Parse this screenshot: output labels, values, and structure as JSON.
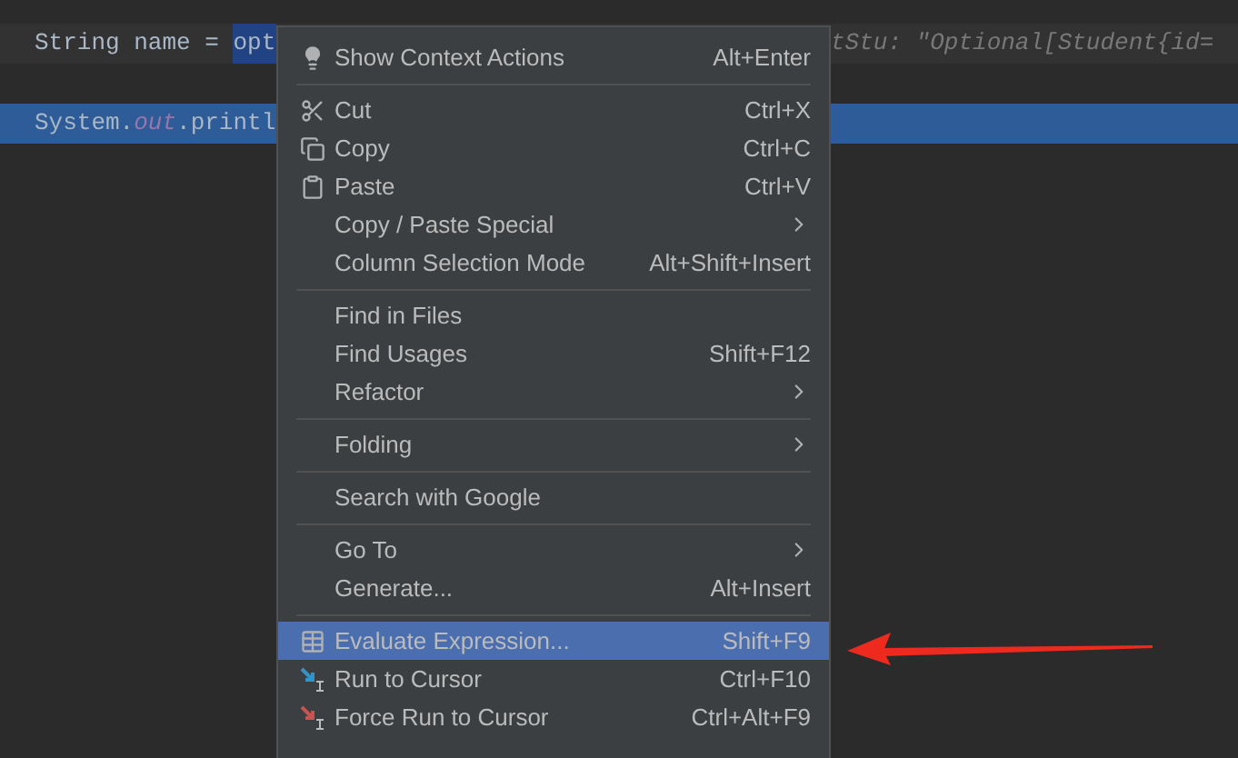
{
  "editor": {
    "lines": [
      {
        "current": true,
        "selected": false,
        "segments": [
          {
            "text": "String name = ",
            "kind": "plain"
          },
          {
            "text": "opt",
            "kind": "selection"
          }
        ],
        "hint": "tStu: \"Optional[Student{id="
      },
      {
        "selected": true,
        "segments": [
          {
            "text": "System.",
            "kind": "plain"
          },
          {
            "text": "out",
            "kind": "field"
          },
          {
            "text": ".printl",
            "kind": "plain"
          }
        ]
      }
    ]
  },
  "context_menu": {
    "items": [
      {
        "kind": "item",
        "label": "Show Context Actions",
        "shortcut": "Alt+Enter",
        "submenu": false,
        "selected": false
      },
      {
        "kind": "separator"
      },
      {
        "kind": "item",
        "label": "Cut",
        "shortcut": "Ctrl+X",
        "submenu": false,
        "selected": false
      },
      {
        "kind": "item",
        "label": "Copy",
        "shortcut": "Ctrl+C",
        "submenu": false,
        "selected": false
      },
      {
        "kind": "item",
        "label": "Paste",
        "shortcut": "Ctrl+V",
        "submenu": false,
        "selected": false
      },
      {
        "kind": "item",
        "label": "Copy / Paste Special",
        "submenu": true,
        "selected": false
      },
      {
        "kind": "item",
        "label": "Column Selection Mode",
        "shortcut": "Alt+Shift+Insert",
        "submenu": false,
        "selected": false
      },
      {
        "kind": "separator"
      },
      {
        "kind": "item",
        "label": "Find in Files",
        "submenu": false,
        "selected": false
      },
      {
        "kind": "item",
        "label": "Find Usages",
        "shortcut": "Shift+F12",
        "submenu": false,
        "selected": false
      },
      {
        "kind": "item",
        "label": "Refactor",
        "submenu": true,
        "selected": false
      },
      {
        "kind": "separator"
      },
      {
        "kind": "item",
        "label": "Folding",
        "submenu": true,
        "selected": false
      },
      {
        "kind": "separator"
      },
      {
        "kind": "item",
        "label": "Search with Google",
        "submenu": false,
        "selected": false
      },
      {
        "kind": "separator"
      },
      {
        "kind": "item",
        "label": "Go To",
        "submenu": true,
        "selected": false
      },
      {
        "kind": "item",
        "label": "Generate...",
        "shortcut": "Alt+Insert",
        "submenu": false,
        "selected": false
      },
      {
        "kind": "separator"
      },
      {
        "kind": "item",
        "label": "Evaluate Expression...",
        "shortcut": "Shift+F9",
        "submenu": false,
        "selected": true
      },
      {
        "kind": "item",
        "label": "Run to Cursor",
        "shortcut": "Ctrl+F10",
        "submenu": false,
        "selected": false
      },
      {
        "kind": "item",
        "label": "Force Run to Cursor",
        "shortcut": "Ctrl+Alt+F9",
        "submenu": false,
        "selected": false
      }
    ]
  }
}
